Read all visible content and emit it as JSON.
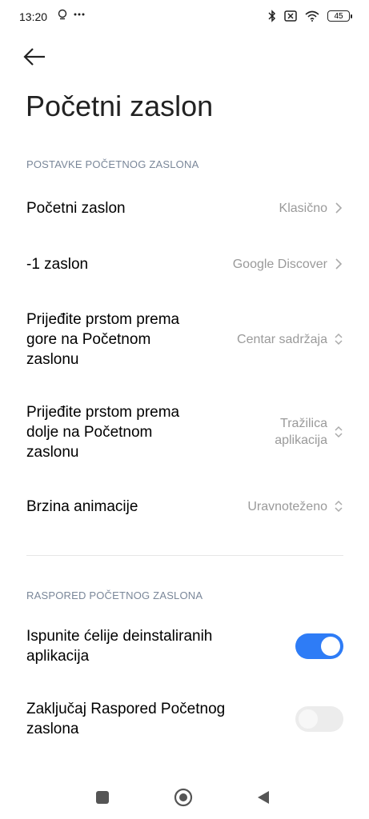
{
  "status": {
    "time": "13:20",
    "battery": "45"
  },
  "page": {
    "title": "Početni zaslon"
  },
  "sections": [
    {
      "header": "POSTAVKE POČETNOG ZASLONA"
    },
    {
      "header": "RASPORED POČETNOG ZASLONA"
    }
  ],
  "rows": [
    {
      "label": "Početni zaslon",
      "value": "Klasično",
      "control": "chevron-right"
    },
    {
      "label": "-1 zaslon",
      "value": "Google Discover",
      "control": "chevron-right"
    },
    {
      "label_lines": [
        "Prijeđite prstom prema",
        "gore na Početnom",
        "zaslonu"
      ],
      "value": "Centar sadržaja",
      "control": "chevron-updown"
    },
    {
      "label_lines": [
        "Prijeđite prstom prema",
        "dolje na Početnom",
        "zaslonu"
      ],
      "value_lines": [
        "Tražilica",
        "aplikacija"
      ],
      "control": "chevron-updown"
    },
    {
      "label": "Brzina animacije",
      "value": "Uravnoteženo",
      "control": "chevron-updown"
    }
  ],
  "toggles": [
    {
      "label_lines": [
        "Ispunite ćelije deinstaliranih",
        "aplikacija"
      ],
      "state": "on"
    },
    {
      "label_lines": [
        "Zaključaj Raspored Početnog",
        "zaslona"
      ],
      "state": "off"
    }
  ],
  "colors": {
    "accent": "#2e7cf6",
    "section_header": "#7a8799",
    "value_text": "#9a9a9a"
  },
  "icons": {
    "status_left": [
      "alarm-icon",
      "more-dots-icon"
    ],
    "status_right": [
      "bluetooth-icon",
      "sim-off-icon",
      "wifi-icon",
      "battery-icon"
    ],
    "nav": [
      "recents-square-icon",
      "home-circle-icon",
      "back-triangle-icon"
    ]
  }
}
